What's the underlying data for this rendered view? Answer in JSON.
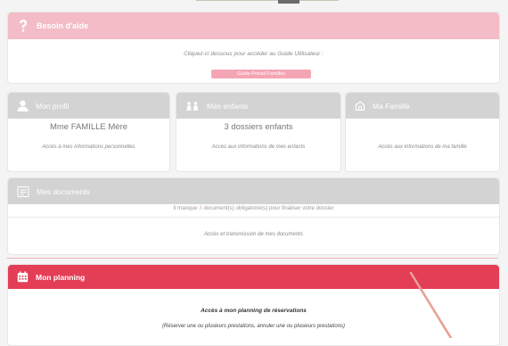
{
  "aide": {
    "title": "Besoin d'aide",
    "text": "Cliquez-ci dessous pour accéder au Guide Utilisateur :",
    "button": "Guide Portail Familles"
  },
  "cards": [
    {
      "title": "Mon profil",
      "main": "Mme FAMILLE Mère",
      "sub": "Accès à mes informations personnelles",
      "icon": "user-icon"
    },
    {
      "title": "Mes enfants",
      "main": "3 dossiers enfants",
      "sub": "Accès aux informations de mes enfants",
      "icon": "children-icon"
    },
    {
      "title": "Ma Famille",
      "main": "",
      "sub": "Accès aux informations de ma famille",
      "icon": "house-icon"
    }
  ],
  "docs": {
    "title": "Mes documents",
    "warn_pre": "Il manque",
    "warn_count": "3",
    "warn_post": "document(s) obligatoire(s) pour finaliser votre dossier",
    "sub": "Accès et transmission de mes documents",
    "icon": "document-icon"
  },
  "planning": {
    "title": "Mon planning",
    "heading": "Accès à mon planning de réservations",
    "sub": "(Réserver une ou plusieurs prestations, annuler une ou plusieurs prestations)",
    "icon": "calendar-icon"
  },
  "colors": {
    "help_header": "#f4bcc6",
    "help_button": "#f4a5b4",
    "card_header": "#d3d3d3",
    "planning_header": "#e43d56"
  }
}
